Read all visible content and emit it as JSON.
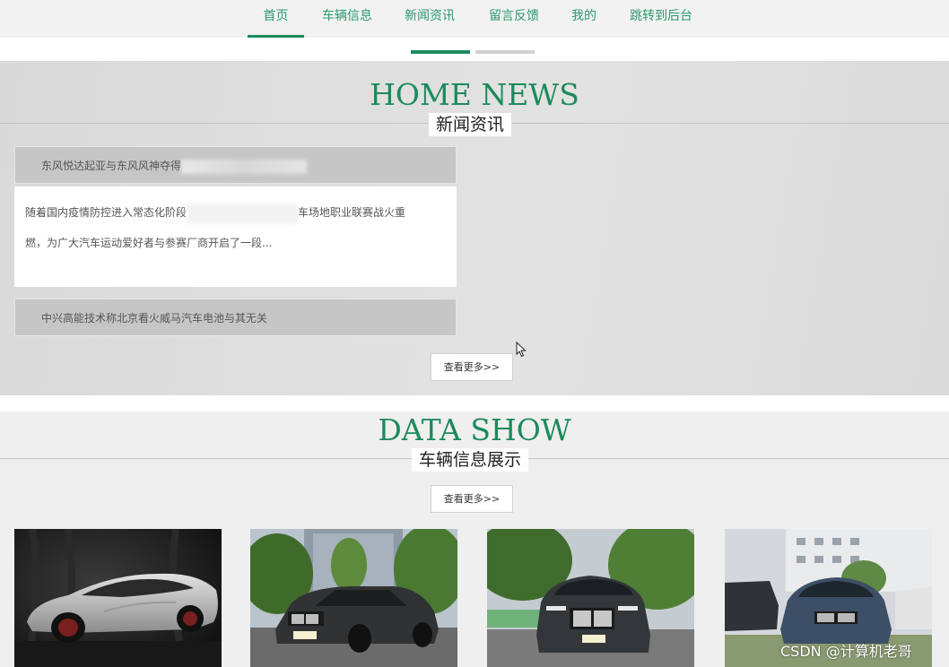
{
  "nav": {
    "items": [
      {
        "label": "首页",
        "active": true
      },
      {
        "label": "车辆信息",
        "active": false
      },
      {
        "label": "新闻资讯",
        "active": false
      },
      {
        "label": "留言反馈",
        "active": false
      },
      {
        "label": "我的",
        "active": false
      },
      {
        "label": "跳转到后台",
        "active": false
      }
    ]
  },
  "carousel": {
    "active_index": 0,
    "count": 2
  },
  "news": {
    "title_en": "HOME NEWS",
    "title_cn": "新闻资讯",
    "items": [
      {
        "title": "东风悦达起亚与东风风神夺得",
        "summary_line1_start": "随着国内疫情防控进入常态化阶段",
        "summary_line1_end": "车场地职业联赛战火重",
        "summary_line2": "燃，为广大汽车运动爱好者与参赛厂商开启了一段..."
      },
      {
        "title": "中兴高能技术称北京看火威马汽车电池与其无关"
      }
    ],
    "more_label": "查看更多>>"
  },
  "data_show": {
    "title_en": "DATA SHOW",
    "title_cn": "车辆信息展示",
    "more_label": "查看更多>>",
    "cars": [
      {
        "icon": "concept-car-image"
      },
      {
        "icon": "sedan-image"
      },
      {
        "icon": "sedan-front-image"
      },
      {
        "icon": "coupe-image"
      }
    ]
  },
  "watermark": "CSDN @计算机老哥",
  "colors": {
    "accent": "#1f8a5e",
    "nav_text": "#2c9a6d"
  }
}
